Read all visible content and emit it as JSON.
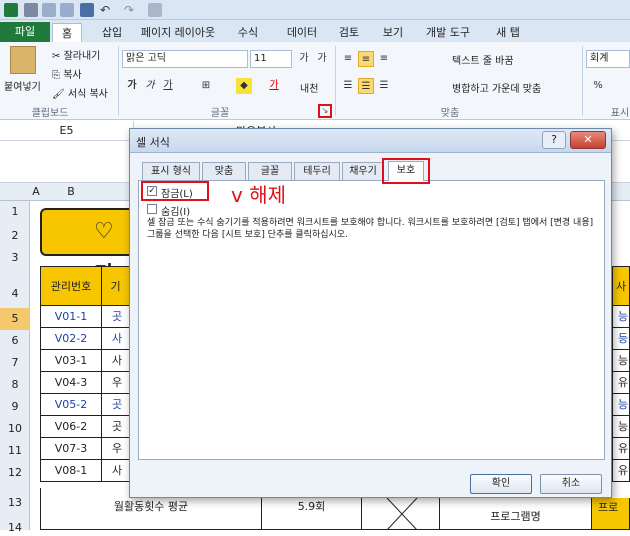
{
  "ribbon_tabs": [
    "파일",
    "홈",
    "삽입",
    "페이지 레이아웃",
    "수식",
    "데이터",
    "검토",
    "보기",
    "개발 도구",
    "새 탭"
  ],
  "clipboard": {
    "paste": "붙여넣기",
    "cut": "잘라내기",
    "copy": "복사",
    "format_painter": "서식 복사",
    "label": "클립보드"
  },
  "font": {
    "name": "맑은 고딕",
    "size": "11",
    "label": "글꼴",
    "bold": "가",
    "italic": "가",
    "underline": "가",
    "color_glyph": "가",
    "phonetic": "내천"
  },
  "alignment": {
    "wrap": "텍스트 줄 바꿈",
    "merge": "병합하고 가운데 맞춤",
    "label": "맞춤"
  },
  "number": {
    "format": "회계",
    "label": "표시"
  },
  "formula_bar": {
    "name_box": "E5",
    "content": "만우분사"
  },
  "columns": [
    "A",
    "B"
  ],
  "rows": [
    "1",
    "2",
    "3",
    "4",
    "5",
    "6",
    "7",
    "8",
    "9",
    "10",
    "11",
    "12",
    "13",
    "14"
  ],
  "sheet": {
    "banner": "♡ 가",
    "header_mgmt": "관리번호",
    "header_c": "기",
    "ids": [
      "V01-1",
      "V02-2",
      "V03-1",
      "V04-3",
      "V05-2",
      "V06-2",
      "V07-3",
      "V08-1"
    ],
    "c_col": [
      "곳",
      "사",
      "사",
      "우리",
      "곳",
      "곳",
      "우리",
      "사"
    ],
    "right_col": [
      "능",
      "등",
      "능",
      "유",
      "능",
      "능",
      "유",
      "유"
    ],
    "avg_label": "월활동횟수 평균",
    "avg_value": "5.9회",
    "program_label": "프로그램명",
    "right_header": "사",
    "right_bottom": "프로"
  },
  "dialog": {
    "title": "셀 서식",
    "help": "?",
    "close": "✕",
    "tabs": [
      "표시 형식",
      "맞춤",
      "글꼴",
      "테두리",
      "채우기",
      "보호"
    ],
    "lock_label": "잠금(L)",
    "lock_checked": true,
    "hidden_label": "숨김(I)",
    "hidden_checked": false,
    "annotation": "v 해제",
    "description": "셀 잠금 또는 수식 숨기기를 적용하려면 워크시트를 보호해야 합니다. 워크시트를 보호하려면 [검토] 탭에서 [변경 내용] 그룹을 선택한 다음 [시트 보호] 단추를 클릭하십시오.",
    "ok": "확인",
    "cancel": "취소"
  },
  "colors": {
    "accent_red": "#e0101a",
    "file_green": "#1f7a3c",
    "banner_yellow": "#f7c600",
    "header_yellow": "#f7c600",
    "id_blue": "#1f3fa6"
  }
}
